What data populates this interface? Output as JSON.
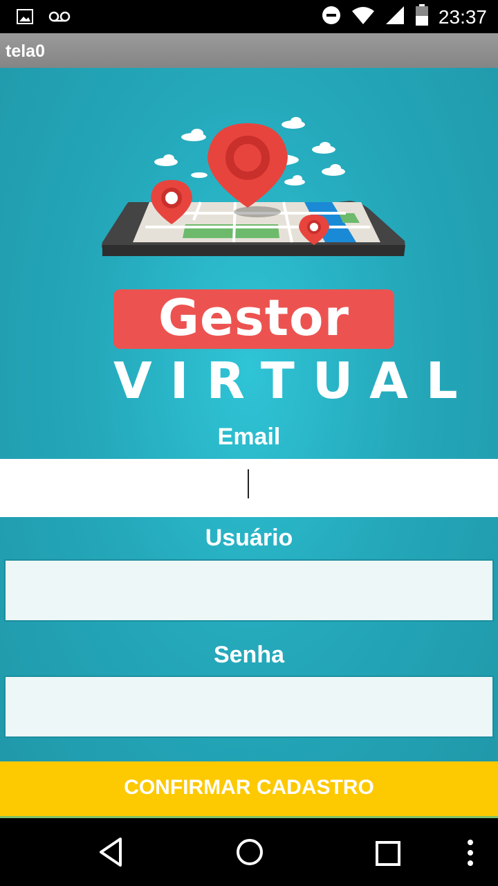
{
  "status_bar": {
    "time": "23:37",
    "icons": [
      "image-icon",
      "voicemail-icon",
      "do-not-disturb-icon",
      "wifi-icon",
      "signal-icon",
      "battery-icon"
    ]
  },
  "app": {
    "title": "tela0"
  },
  "logo": {
    "line1": "Gestor",
    "line2": "VIRTUAL"
  },
  "form": {
    "email_label": "Email",
    "email_value": "",
    "user_label": "Usuário",
    "user_value": "",
    "password_label": "Senha",
    "password_value": "",
    "confirm_label": "CONFIRMAR CADASTRO"
  },
  "nav": {
    "icons": [
      "back-icon",
      "home-icon",
      "recents-icon",
      "menu-icon"
    ]
  },
  "colors": {
    "accent_yellow": "#fdc900",
    "logo_red": "#ec5350",
    "background_teal": "#24a8ba"
  }
}
